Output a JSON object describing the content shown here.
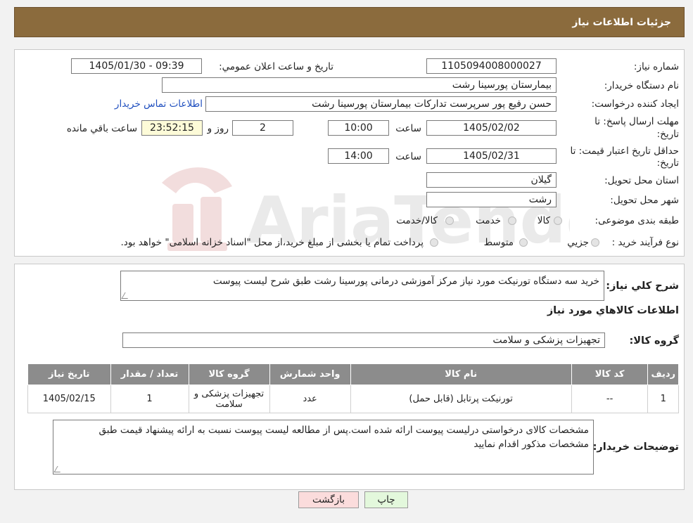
{
  "header": {
    "title": "جزئیات اطلاعات نیاز"
  },
  "form": {
    "need_number_label": "شماره نیاز:",
    "need_number": "1105094008000027",
    "announce_label": "تاریخ و ساعت اعلان عمومي:",
    "announce_value": "1405/01/30 - 09:39",
    "buyer_org_label": "نام دستگاه خريدار:",
    "buyer_org": "بيمارستان پورسينا رشت",
    "requester_label": "ايجاد کننده درخواست:",
    "requester": "حسن رفیع پور سرپرست تداركات بيمارستان پورسينا رشت",
    "contact_link": "اطلاعات تماس خريدار",
    "deadline_label_1": "مهلت ارسال پاسخ: تا",
    "deadline_label_2": "تاريخ:",
    "deadline_date": "1405/02/02",
    "time_label": "ساعت",
    "deadline_time": "10:00",
    "days_value": "2",
    "days_label": "روز و",
    "remaining_value": "23:52:15",
    "remaining_label": "ساعت باقي مانده",
    "validity_label_1": "حداقل تاريخ اعتبار قيمت: تا",
    "validity_label_2": "تاريخ:",
    "validity_date": "1405/02/31",
    "validity_time": "14:00",
    "province_label": "استان محل تحويل:",
    "province": "گيلان",
    "city_label": "شهر محل تحويل:",
    "city": "رشت",
    "category_label": "طبقه بندی موضوعی:",
    "category_options": [
      "کالا",
      "خدمت",
      "کالا/خدمت"
    ],
    "process_label": "نوع فرآيند خريد :",
    "process_options": [
      "جزيي",
      "متوسط"
    ],
    "process_note": "پرداخت تمام يا بخشی از مبلغ خريد،از محل \"اسناد خزانه اسلامی\" خواهد بود."
  },
  "watermark_text": "AriaTender.neT",
  "description": {
    "label": "شرح کلي نياز:",
    "text": "خريد سه دستگاه تورنيكت مورد نياز مركز آموزشی درمانی پورسينا رشت طبق شرح ليست پيوست"
  },
  "goods": {
    "section_title": "اطلاعات کالاهاي مورد نياز",
    "group_label": "گروه کالا:",
    "group_value": "تجهيزات پزشکی و سلامت",
    "columns": [
      "رديف",
      "کد کالا",
      "نام کالا",
      "واحد شمارش",
      "گروه کالا",
      "تعداد / مقدار",
      "تاريخ نياز"
    ],
    "rows": [
      [
        "1",
        "--",
        "تورنيكت پرتابل (قابل حمل)",
        "عدد",
        "تجهيزات پزشکی و سلامت",
        "1",
        "1405/02/15"
      ]
    ]
  },
  "buyer_notes": {
    "label": "توضيحات خريدار:",
    "text": "مشخصات كالای درخواستی درليست پيوست ارائه شده است.پس از مطالعه ليست پيوست نسبت به ارائه پيشنهاد قيمت طبق مشخصات مذكور اقدام نماييد"
  },
  "buttons": {
    "back": "بازگشت",
    "print": "چاپ"
  }
}
